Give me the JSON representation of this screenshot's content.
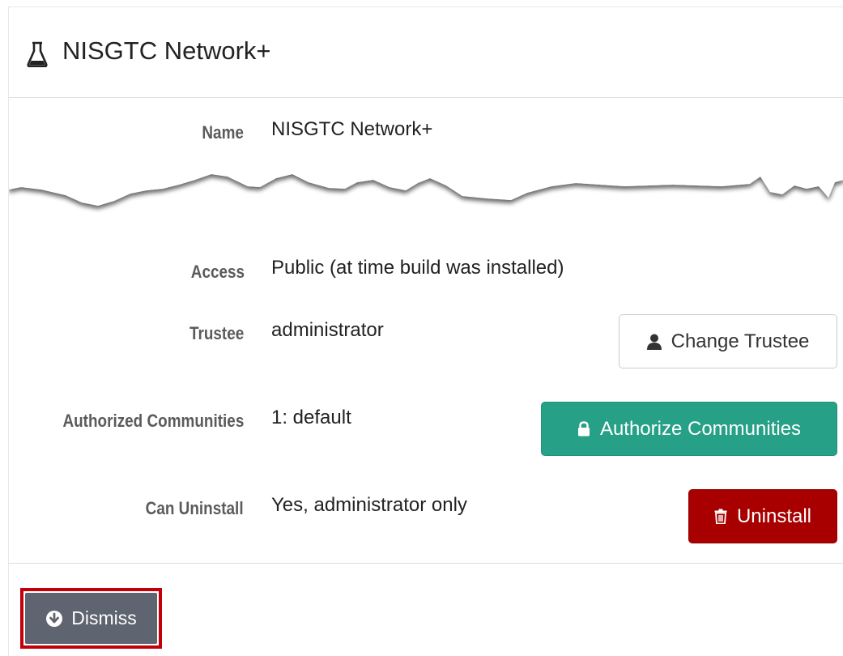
{
  "header": {
    "title": "NISGTC Network+",
    "icon": "flask-icon"
  },
  "details": {
    "name_label": "Name",
    "name_value": "NISGTC Network+",
    "access_label": "Access",
    "access_value": "Public (at time build was installed)",
    "trustee_label": "Trustee",
    "trustee_value": "administrator",
    "communities_label": "Authorized Communities",
    "communities_value": "1: default",
    "uninstall_label": "Can Uninstall",
    "uninstall_value": "Yes, administrator only"
  },
  "buttons": {
    "change_trustee": "Change Trustee",
    "authorize_communities": "Authorize Communities",
    "uninstall": "Uninstall",
    "dismiss": "Dismiss"
  },
  "colors": {
    "authorize": "#26a086",
    "uninstall": "#a80000",
    "dismiss": "#5e6470",
    "highlight": "#c10008"
  }
}
